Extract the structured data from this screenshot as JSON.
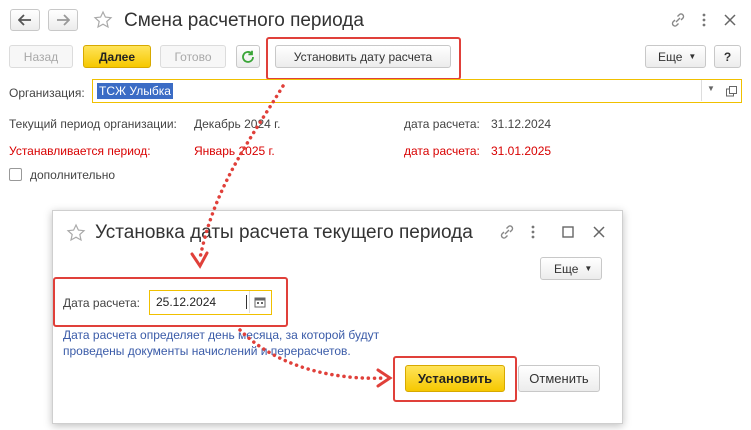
{
  "main_window": {
    "title": "Смена расчетного периода",
    "toolbar": {
      "back_label": "Назад",
      "next_label": "Далее",
      "done_label": "Готово",
      "set_date_label": "Установить дату расчета",
      "more_label": "Еще",
      "help_label": "?"
    },
    "organization": {
      "label": "Организация:",
      "value": "ТСЖ Улыбка"
    },
    "current_period": {
      "label": "Текущий период организации:",
      "value": "Декабрь 2024 г.",
      "date_label": "дата расчета:",
      "date_value": "31.12.2024"
    },
    "new_period": {
      "label": "Устанавливается период:",
      "value": "Январь 2025 г.",
      "date_label": "дата расчета:",
      "date_value": "31.01.2025"
    },
    "additional_label": "дополнительно"
  },
  "dialog": {
    "title": "Установка даты расчета текущего периода",
    "more_label": "Еще",
    "date_label": "Дата расчета:",
    "date_value": "25.12.2024",
    "hint_line1": "Дата расчета определяет день месяца, за которой будут",
    "hint_line2": "проведены документы начислений и перерасчетов.",
    "set_label": "Установить",
    "cancel_label": "Отменить"
  },
  "colors": {
    "accent_yellow": "#f6c800",
    "annotation_red": "#e0403a",
    "text_red": "#d80000",
    "hint_blue": "#3a5ba8"
  }
}
